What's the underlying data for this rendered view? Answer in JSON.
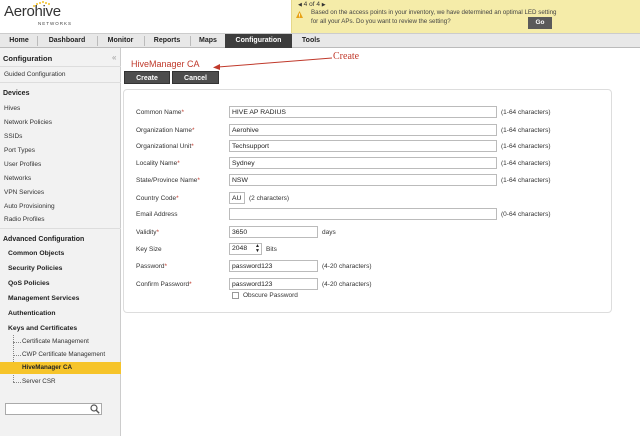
{
  "header": {
    "brand": "Aerohive",
    "brand_sub": "NETWORKS",
    "notice": {
      "pager": "4 of 4",
      "message_line1": "Based on the access points in your inventory, we have determined an optimal LED setting",
      "message_line2": "for all your APs. Do you want to review the setting?",
      "go_label": "Go"
    }
  },
  "nav": {
    "tabs": [
      {
        "label": "Home"
      },
      {
        "label": "Dashboard"
      },
      {
        "label": "Monitor"
      },
      {
        "label": "Reports"
      },
      {
        "label": "Maps"
      },
      {
        "label": "Configuration"
      },
      {
        "label": "Tools"
      }
    ]
  },
  "sidebar": {
    "title": "Configuration",
    "collapse_icon": "double-chevron-left",
    "guided": "Guided Configuration",
    "devices_head": "Devices",
    "device_items": [
      "Hives",
      "Network Policies",
      "SSIDs",
      "Port Types",
      "User Profiles",
      "Networks",
      "VPN Services",
      "Auto Provisioning",
      "Radio Profiles"
    ],
    "advanced_head": "Advanced Configuration",
    "advanced_items": [
      "Common Objects",
      "Security Policies",
      "QoS Policies",
      "Management Services",
      "Authentication",
      "Keys and Certificates"
    ],
    "cert_items": [
      "Certificate Management",
      "CWP Certificate Management",
      "HiveManager CA",
      "Server CSR"
    ],
    "search_placeholder": ""
  },
  "main": {
    "title": "HiveManager CA",
    "annotation": "Create",
    "create_label": "Create",
    "cancel_label": "Cancel",
    "fields": {
      "common_name": {
        "label": "Common Name",
        "value": "HIVE AP RADIUS",
        "hint": "(1-64 characters)"
      },
      "org_name": {
        "label": "Organization Name",
        "value": "Aerohive",
        "hint": "(1-64 characters)"
      },
      "org_unit": {
        "label": "Organizational Unit",
        "value": "Techsupport",
        "hint": "(1-64 characters)"
      },
      "locality": {
        "label": "Locality Name",
        "value": "Sydney",
        "hint": "(1-64 characters)"
      },
      "state": {
        "label": "State/Province Name",
        "value": "NSW",
        "hint": "(1-64 characters)"
      },
      "country": {
        "label": "Country Code",
        "value": "AU",
        "hint": "(2 characters)"
      },
      "email": {
        "label": "Email Address",
        "value": "",
        "hint": "(0-64 characters)"
      },
      "validity": {
        "label": "Validity",
        "value": "3650",
        "hint": "days"
      },
      "key_size": {
        "label": "Key Size",
        "value": "2048",
        "hint": "Bits"
      },
      "password": {
        "label": "Password",
        "value": "password123",
        "hint": "(4-20 characters)"
      },
      "confirm": {
        "label": "Confirm Password",
        "value": "password123",
        "hint": "(4-20 characters)"
      }
    },
    "obscure_label": "Obscure Password"
  },
  "colors": {
    "accent_red": "#c0392b",
    "selected_yellow": "#f6c42a",
    "nav_active": "#3d3d3d",
    "notice_bg": "#f5eca9"
  }
}
